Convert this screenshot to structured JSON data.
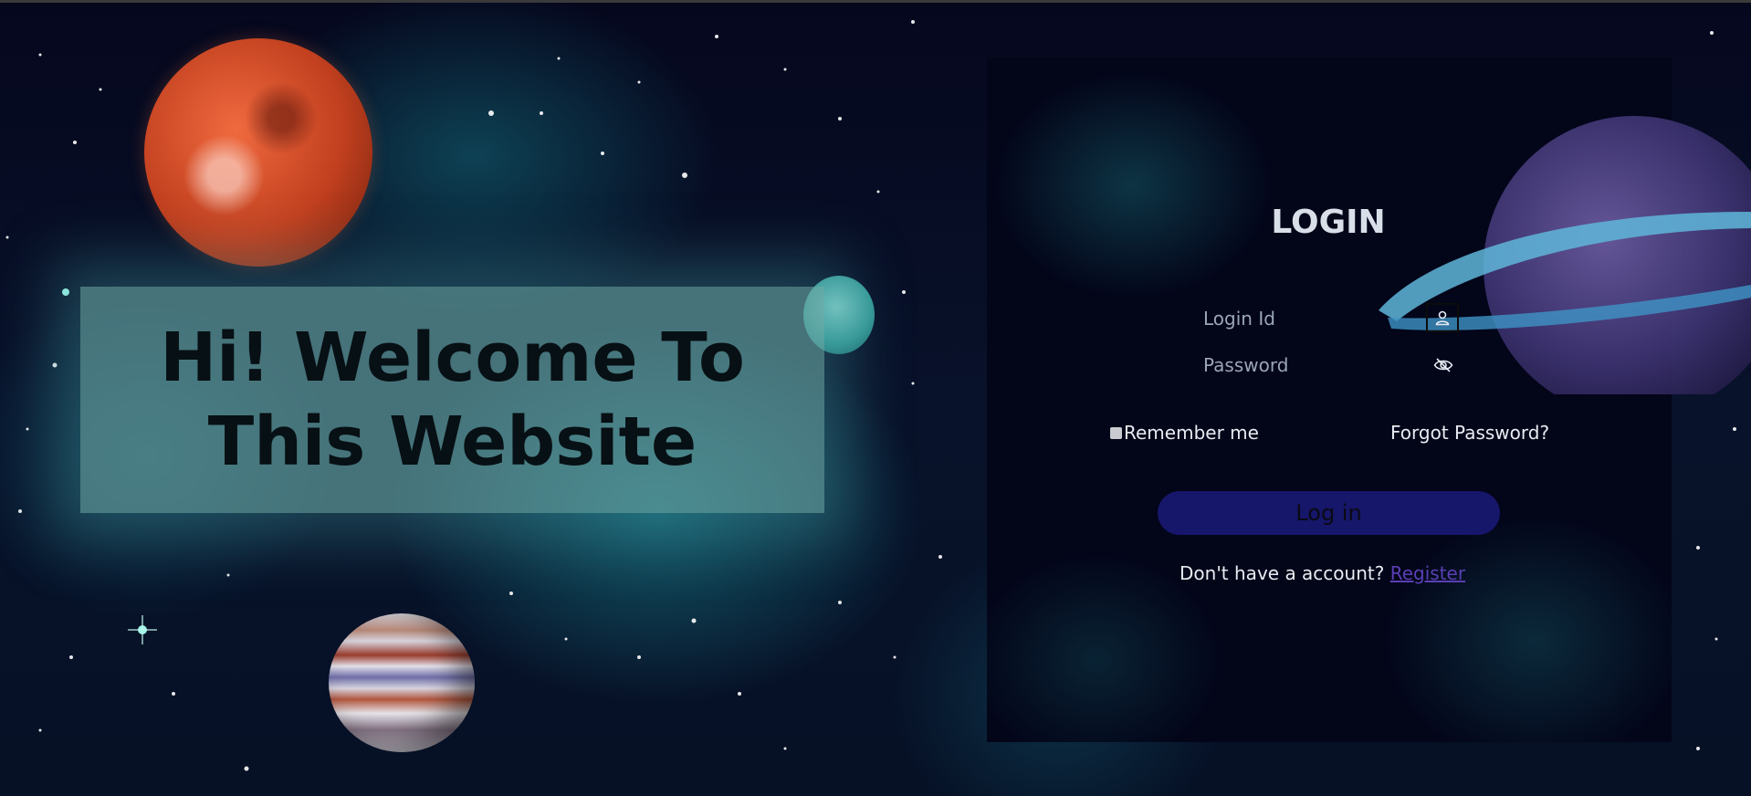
{
  "welcome": {
    "title": "Hi! Welcome To This Website"
  },
  "login": {
    "title": "LOGIN",
    "login_id": {
      "placeholder": "Login Id",
      "value": "",
      "icon": "user-icon"
    },
    "password": {
      "placeholder": "Password",
      "value": "",
      "icon": "eye-slash-icon"
    },
    "remember_label": "Remember me",
    "remember_checked": false,
    "forgot_label": "Forgot Password?",
    "submit_label": "Log in",
    "register_prompt": "Don't have a account?",
    "register_link": "Register"
  },
  "colors": {
    "panel_bg": "#030519",
    "button_bg": "#16166a",
    "link": "#5a3fb4",
    "welcome_panel": "#68a8a6"
  }
}
